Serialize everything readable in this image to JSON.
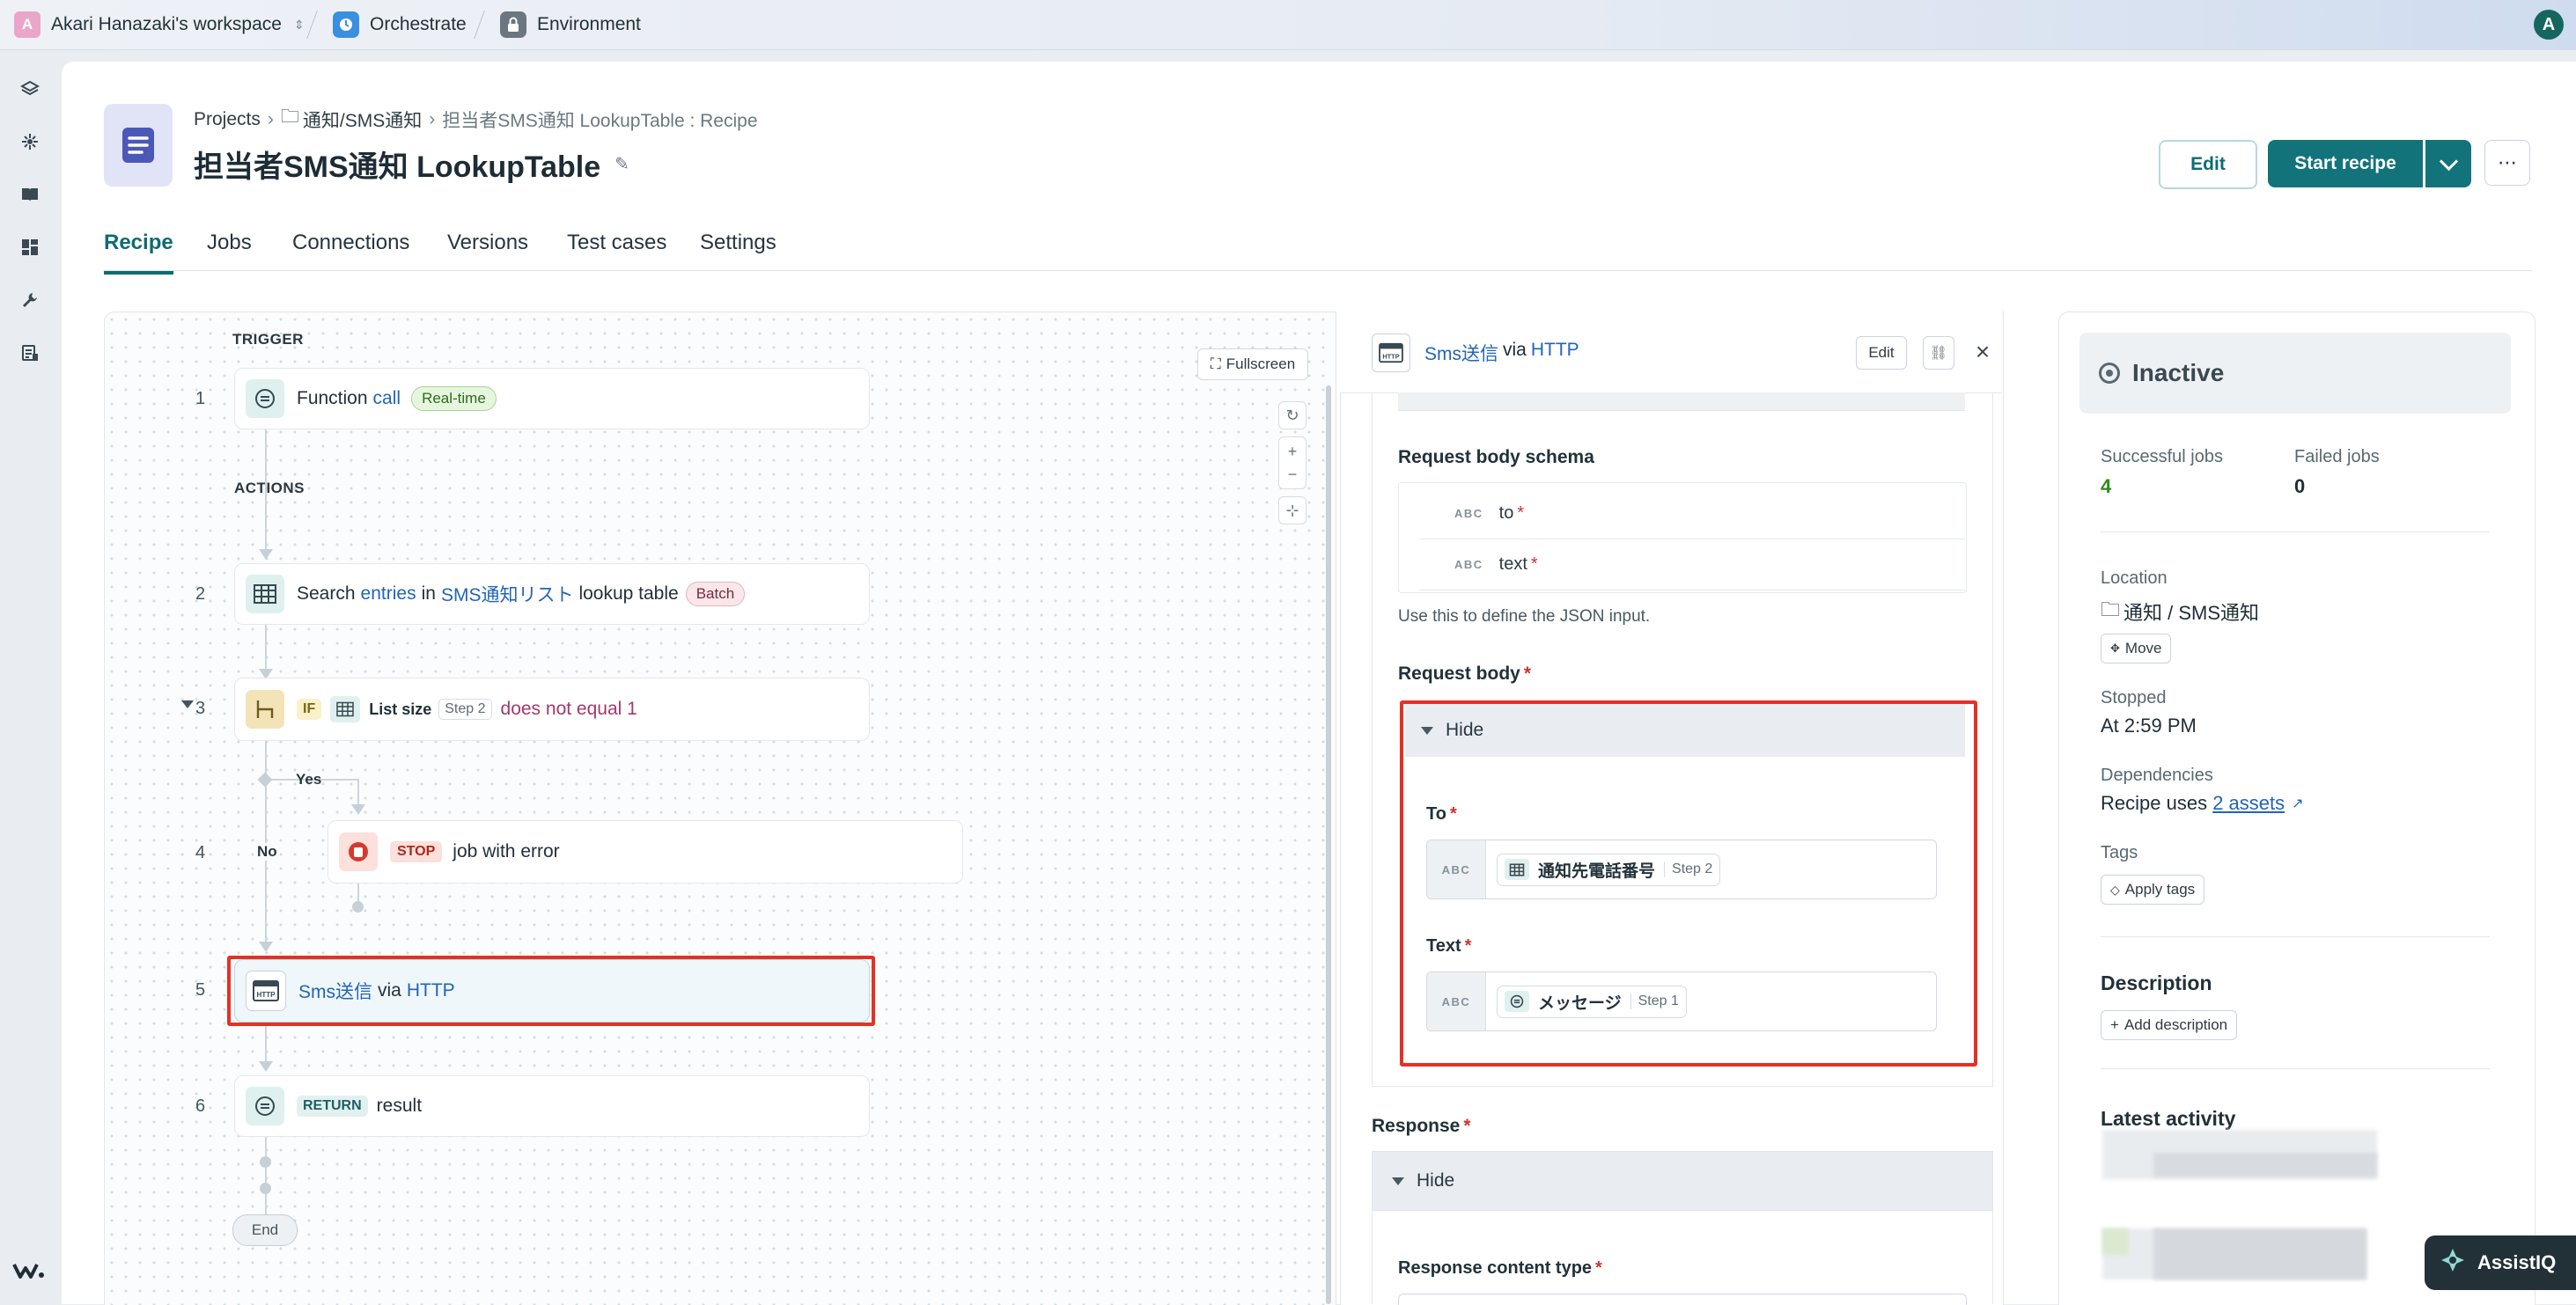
{
  "topbar": {
    "workspace_initial": "A",
    "workspace": "Akari Hanazaki's workspace",
    "orchestrate": "Orchestrate",
    "environment": "Environment",
    "user_initial": "A"
  },
  "breadcrumb": {
    "projects": "Projects",
    "folder": "通知/SMS通知",
    "current": "担当者SMS通知 LookupTable : Recipe"
  },
  "recipe_title": "担当者SMS通知 LookupTable",
  "header_buttons": {
    "edit": "Edit",
    "start": "Start recipe",
    "more": "⋯"
  },
  "tabs": [
    "Recipe",
    "Jobs",
    "Connections",
    "Versions",
    "Test cases",
    "Settings"
  ],
  "canvas": {
    "fullscreen": "Fullscreen",
    "trigger_label": "TRIGGER",
    "actions_label": "ACTIONS",
    "steps": [
      {
        "num": "1",
        "a": "Function ",
        "b": "call",
        "badge": "Real-time"
      },
      {
        "num": "2",
        "a": "Search ",
        "b": "entries",
        "c": " in ",
        "d": "SMS通知リスト",
        "e": " lookup table",
        "badge": "Batch"
      },
      {
        "num": "3",
        "if": "IF",
        "field": "List size",
        "step": "Step 2",
        "cond": "does not equal 1"
      },
      {
        "num": "4",
        "stop": "STOP",
        "text": "job with error"
      },
      {
        "num": "5",
        "a": "Sms送信",
        "b": " via ",
        "c": "HTTP"
      },
      {
        "num": "6",
        "ret": "RETURN",
        "text": "result"
      }
    ],
    "yes": "Yes",
    "no": "No",
    "end": "End"
  },
  "detail": {
    "title_a": "Sms送信",
    "title_b": " via ",
    "title_c": "HTTP",
    "edit": "Edit",
    "schema_label": "Request body schema",
    "schema_fields": [
      {
        "type": "ABC",
        "name": "to"
      },
      {
        "type": "ABC",
        "name": "text"
      }
    ],
    "schema_help": "Use this to define the JSON input.",
    "body_label": "Request body",
    "hide": "Hide",
    "to_label": "To",
    "to_chip": "通知先電話番号",
    "to_step": "Step 2",
    "text_label": "Text",
    "text_chip": "メッセージ",
    "text_step": "Step 1",
    "abc": "ABC",
    "response_label": "Response",
    "response_hide": "Hide",
    "response_type_label": "Response content type"
  },
  "status": {
    "state": "Inactive",
    "successful_label": "Successful jobs",
    "successful": "4",
    "failed_label": "Failed jobs",
    "failed": "0",
    "location_label": "Location",
    "location": "通知 / SMS通知",
    "move": "Move",
    "stopped_label": "Stopped",
    "stopped": "At 2:59 PM",
    "deps_label": "Dependencies",
    "deps_text": "Recipe uses ",
    "deps_link": "2 assets",
    "tags_label": "Tags",
    "apply_tags": "Apply tags",
    "desc_label": "Description",
    "add_desc": "Add description",
    "activity_label": "Latest activity"
  },
  "assist": "AssistIQ",
  "colors": {
    "accent": "#13737b",
    "link": "#2264b8",
    "highlight": "#e53124",
    "success": "#2f8a1f"
  }
}
